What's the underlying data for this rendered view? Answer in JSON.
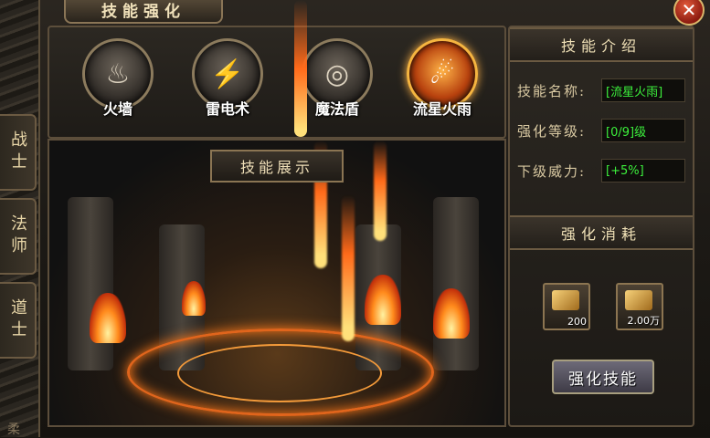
{
  "window": {
    "title": "技能强化",
    "close_symbol": "✕"
  },
  "side_tabs": [
    {
      "label": "战士"
    },
    {
      "label": "法师"
    },
    {
      "label": "道士"
    }
  ],
  "bottom_char": "柔",
  "skills": [
    {
      "label": "火墙",
      "icon": "firewall-icon",
      "glyph": "♨"
    },
    {
      "label": "雷电术",
      "icon": "lightning-icon",
      "glyph": "⚡"
    },
    {
      "label": "魔法盾",
      "icon": "magic-shield-icon",
      "glyph": "◎"
    },
    {
      "label": "流星火雨",
      "icon": "meteor-rain-icon",
      "glyph": "☄",
      "active": true
    }
  ],
  "showcase": {
    "title": "技能展示"
  },
  "info": {
    "header": "技能介绍",
    "name_label": "技能名称:",
    "name_value": "[流星火雨]",
    "level_label": "强化等级:",
    "level_value": "[0/9]级",
    "power_label": "下级威力:",
    "power_value": "[+5%]"
  },
  "cost": {
    "header": "强化消耗",
    "items": [
      {
        "icon": "gold-bars-icon",
        "qty": "200"
      },
      {
        "icon": "gold-ingot-icon",
        "qty": "2.00万"
      }
    ]
  },
  "enhance_button": "强化技能",
  "colors": {
    "value_text": "#3cf03c",
    "accent": "#f5b540"
  }
}
